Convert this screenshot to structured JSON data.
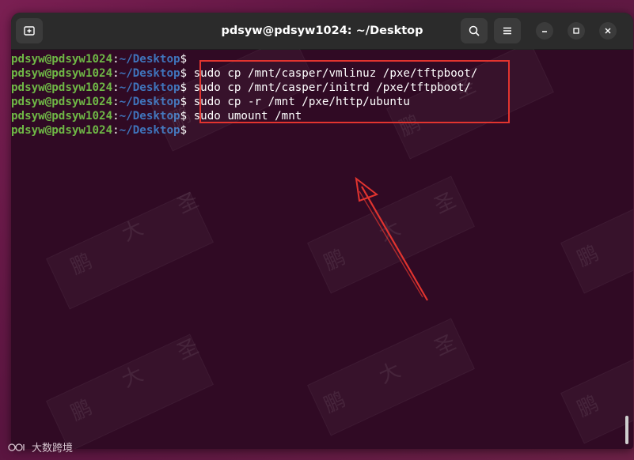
{
  "window": {
    "title": "pdsyw@pdsyw1024: ~/Desktop"
  },
  "titlebar": {
    "new_tab_icon": "new-tab-icon",
    "search_icon": "search-icon",
    "menu_icon": "hamburger-menu-icon",
    "minimize_icon": "minimize-icon",
    "maximize_icon": "maximize-icon",
    "close_icon": "close-icon"
  },
  "prompt": {
    "user_host": "pdsyw@pdsyw1024",
    "colon": ":",
    "path": "~/Desktop",
    "dollar": "$"
  },
  "terminal": {
    "lines": [
      {
        "command": ""
      },
      {
        "command": " sudo cp /mnt/casper/vmlinuz /pxe/tftpboot/"
      },
      {
        "command": " sudo cp /mnt/casper/initrd /pxe/tftpboot/"
      },
      {
        "command": " sudo cp -r /mnt /pxe/http/ubuntu"
      },
      {
        "command": " sudo umount /mnt"
      },
      {
        "command": ""
      }
    ]
  },
  "footer": {
    "brand_text": "大数跨境"
  },
  "watermark": {
    "chars": [
      "鹏",
      "大",
      "圣"
    ]
  },
  "colors": {
    "terminal_bg": "#300a24",
    "titlebar_bg": "#2b2b2b",
    "prompt_user": "#6fb846",
    "prompt_path": "#3f74bb",
    "annotation_red": "#e2342f"
  }
}
